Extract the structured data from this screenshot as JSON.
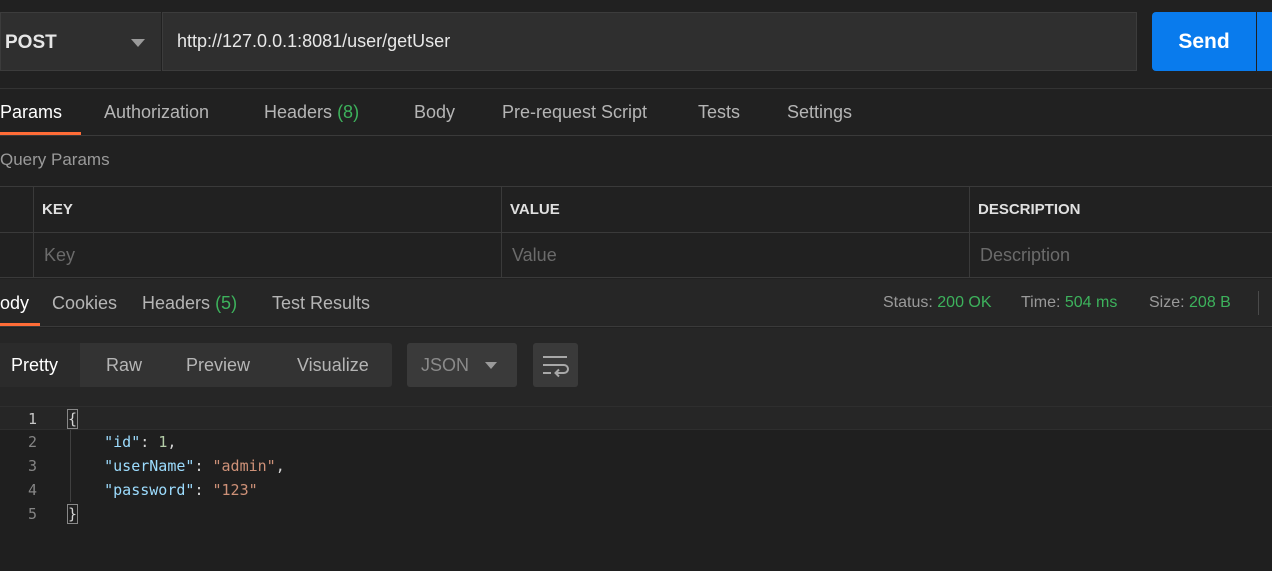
{
  "request": {
    "method": "POST",
    "url": "http://127.0.0.1:8081/user/getUser",
    "send_label": "Send"
  },
  "request_tabs": [
    {
      "label": "Params",
      "active": true
    },
    {
      "label": "Authorization"
    },
    {
      "label": "Headers",
      "count": "(8)"
    },
    {
      "label": "Body"
    },
    {
      "label": "Pre-request Script"
    },
    {
      "label": "Tests"
    },
    {
      "label": "Settings"
    }
  ],
  "query_params": {
    "title": "Query Params",
    "columns": [
      "KEY",
      "VALUE",
      "DESCRIPTION"
    ],
    "placeholders": [
      "Key",
      "Value",
      "Description"
    ]
  },
  "response_tabs": [
    {
      "label": "ody",
      "active": true
    },
    {
      "label": "Cookies"
    },
    {
      "label": "Headers",
      "count": "(5)"
    },
    {
      "label": "Test Results"
    }
  ],
  "response_meta": {
    "status_label": "Status:",
    "status_value": "200 OK",
    "time_label": "Time:",
    "time_value": "504 ms",
    "size_label": "Size:",
    "size_value": "208 B"
  },
  "response_views": [
    {
      "label": "Pretty",
      "active": true
    },
    {
      "label": "Raw"
    },
    {
      "label": "Preview"
    },
    {
      "label": "Visualize"
    }
  ],
  "response_format": "JSON",
  "code": {
    "line_numbers": [
      "1",
      "2",
      "3",
      "4",
      "5"
    ],
    "open_brace": "{",
    "close_brace": "}",
    "fields": [
      {
        "key": "\"id\"",
        "value": "1",
        "type": "number",
        "trail": ","
      },
      {
        "key": "\"userName\"",
        "value": "\"admin\"",
        "type": "string",
        "trail": ","
      },
      {
        "key": "\"password\"",
        "value": "\"123\"",
        "type": "string",
        "trail": ""
      }
    ]
  },
  "watermark": "",
  "colors": {
    "accent": "#ff6c37",
    "send": "#097bed",
    "success": "#3db25c"
  }
}
